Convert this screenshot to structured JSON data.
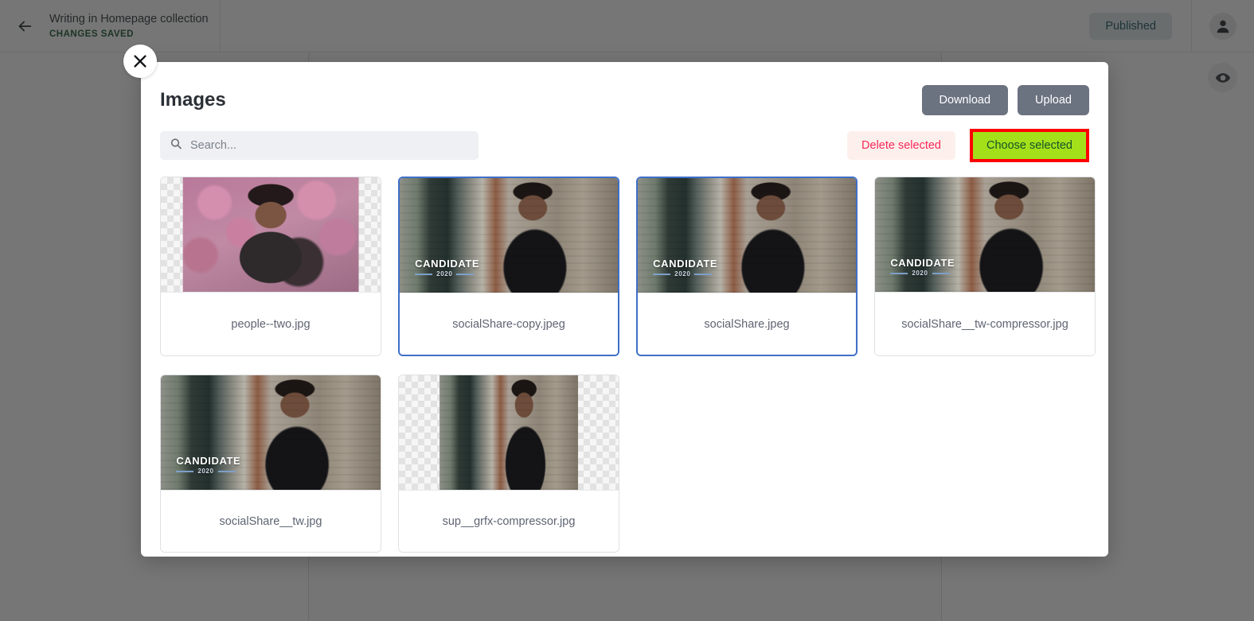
{
  "topbar": {
    "back_icon": "arrow-left-icon",
    "doc_title": "Writing in Homepage collection",
    "save_status": "CHANGES SAVED",
    "published_label": "Published",
    "avatar_icon": "user-avatar-icon",
    "preview_icon": "eye-icon"
  },
  "modal": {
    "close_icon": "close-icon",
    "title": "Images",
    "download_label": "Download",
    "upload_label": "Upload",
    "search": {
      "icon": "search-icon",
      "value": "",
      "placeholder": "Search..."
    },
    "delete_label": "Delete selected",
    "choose_label": "Choose selected",
    "items": [
      {
        "filename": "people--two.jpg",
        "selected": false,
        "scene": "blossom",
        "fit": "mid",
        "overlay": null
      },
      {
        "filename": "socialShare-copy.jpeg",
        "selected": true,
        "scene": "street",
        "fit": "wide",
        "overlay": {
          "title": "CANDIDATE",
          "year": "2020"
        }
      },
      {
        "filename": "socialShare.jpeg",
        "selected": true,
        "scene": "street",
        "fit": "wide",
        "overlay": {
          "title": "CANDIDATE",
          "year": "2020"
        }
      },
      {
        "filename": "socialShare__tw-compressor.jpg",
        "selected": false,
        "scene": "street",
        "fit": "wide",
        "overlay": {
          "title": "CANDIDATE",
          "year": "2020"
        }
      },
      {
        "filename": "socialShare__tw.jpg",
        "selected": false,
        "scene": "street",
        "fit": "wide",
        "overlay": {
          "title": "CANDIDATE",
          "year": "2020"
        }
      },
      {
        "filename": "sup__grfx-compressor.jpg",
        "selected": false,
        "scene": "street",
        "fit": "narrow",
        "overlay": null
      }
    ]
  },
  "colors": {
    "accent_selected": "#3F6FC8",
    "danger": "#F8285A",
    "highlight_green": "#A4E01A",
    "annotation_red": "#FF0000",
    "published_bg": "#DCE6EA",
    "saved_green": "#14532A"
  }
}
